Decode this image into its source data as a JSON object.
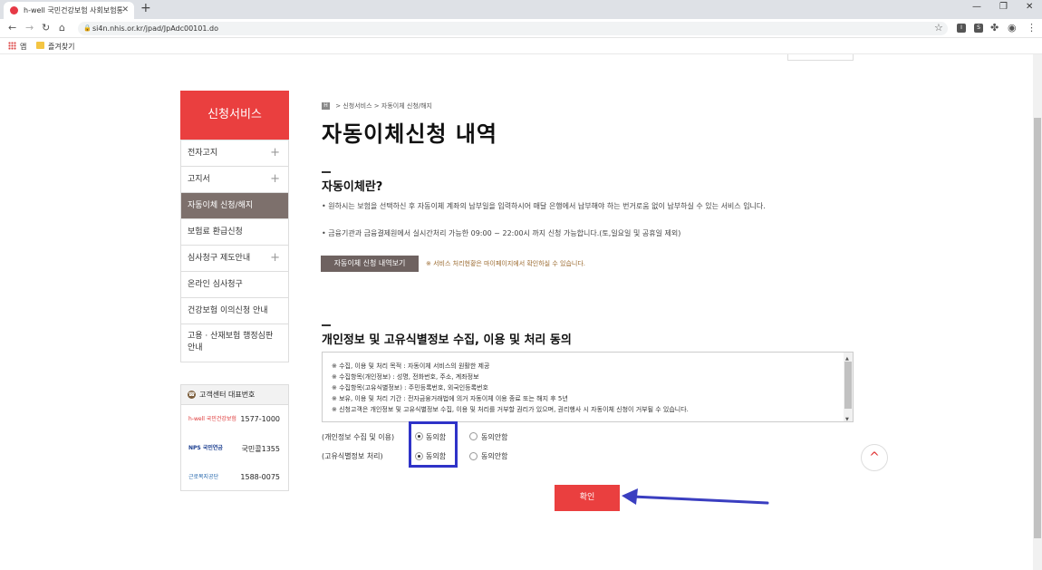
{
  "browser": {
    "tab_title": "h-well 국민건강보험 사회보험통",
    "tab_close": "✕",
    "new_tab": "+",
    "url": "si4n.nhis.or.kr/jpad/JpAdc00101.do",
    "bookmarks": [
      "앱",
      "즐겨찾기"
    ],
    "ext_labels": [
      "I",
      "S"
    ]
  },
  "sidebar": {
    "header": "신청서비스",
    "items": [
      {
        "label": "전자고지",
        "plus": "+"
      },
      {
        "label": "고지서",
        "plus": "+"
      },
      {
        "label": "자동이체 신청/해지",
        "plus": ""
      },
      {
        "label": "보험료 환급신청",
        "plus": ""
      },
      {
        "label": "심사청구 제도안내",
        "plus": "+"
      },
      {
        "label": "온라인 심사청구",
        "plus": ""
      },
      {
        "label": "건강보험 이의신청 안내",
        "plus": ""
      },
      {
        "label": "고용 · 산재보험 행정심판 안내",
        "plus": ""
      }
    ],
    "customer_center": {
      "title": "고객센터 대표번호",
      "rows": [
        {
          "logo": "h-well 국민건강보험",
          "number": "1577-1000"
        },
        {
          "logo": "NPS 국민연금",
          "number": "국민콜1355"
        },
        {
          "logo": "근로복지공단",
          "number": "1588-0075"
        }
      ]
    }
  },
  "main": {
    "breadcrumb": [
      ">",
      "신청서비스",
      ">",
      "자동이체 신청/해지"
    ],
    "breadcrumb_home": "H",
    "title": "자동이체신청 내역",
    "section1": {
      "title": "자동이체란?",
      "bullets": [
        "• 원하시는 보험을 선택하신 후 자동이체 계좌의 납부일을 입력하시어 매달 은행에서 납부해야 하는 번거로움 없이 납부하실 수 있는 서비스 입니다.",
        "• 금융기관과 금융결제원에서 실시간처리 가능한 09:00 ~ 22:00시 까지 신청 가능합니다.(토,일요일 및 공휴일 제외)"
      ],
      "view_button": "자동이체 신청 내역보기",
      "note": "※ 서비스 처리현황은 마이페이지에서 확인하실 수 있습니다."
    },
    "section2": {
      "title": "개인정보 및 고유식별정보 수집, 이용 및 처리 동의",
      "consent_lines": [
        "※ 수집, 이용 및 처리 목적 : 자동이체 서비스의 원활한 제공",
        "※ 수집항목(개인정보) : 성명, 전화번호, 주소, 계좌정보",
        "※ 수집항목(고유식별정보) : 주민등록번호, 외국인등록번호",
        "※ 보유, 이용 및 처리 기간 : 전자금융거래법에 의거 자동이체 이용 종료 또는 해지 후 5년",
        "※ 신청고객은 개인정보 및 고유식별정보 수집, 이용 및 처리를 거부할 권리가 있으며, 권리행사 시 자동이체 신청이 거부될 수 있습니다."
      ],
      "consent_rows": [
        {
          "label": "(개인정보 수집 및 이용)",
          "agree": "동의함",
          "disagree": "동의안함",
          "selected": "agree"
        },
        {
          "label": "(고유식별정보 처리)",
          "agree": "동의함",
          "disagree": "동의안함",
          "selected": "agree"
        }
      ]
    },
    "confirm_button": "확인",
    "top_button": "^"
  },
  "colors": {
    "brand_red": "#ea3f3f",
    "active_menu": "#7d706c",
    "highlight_box": "#2f33c8",
    "arrow": "#3a3ec0"
  }
}
